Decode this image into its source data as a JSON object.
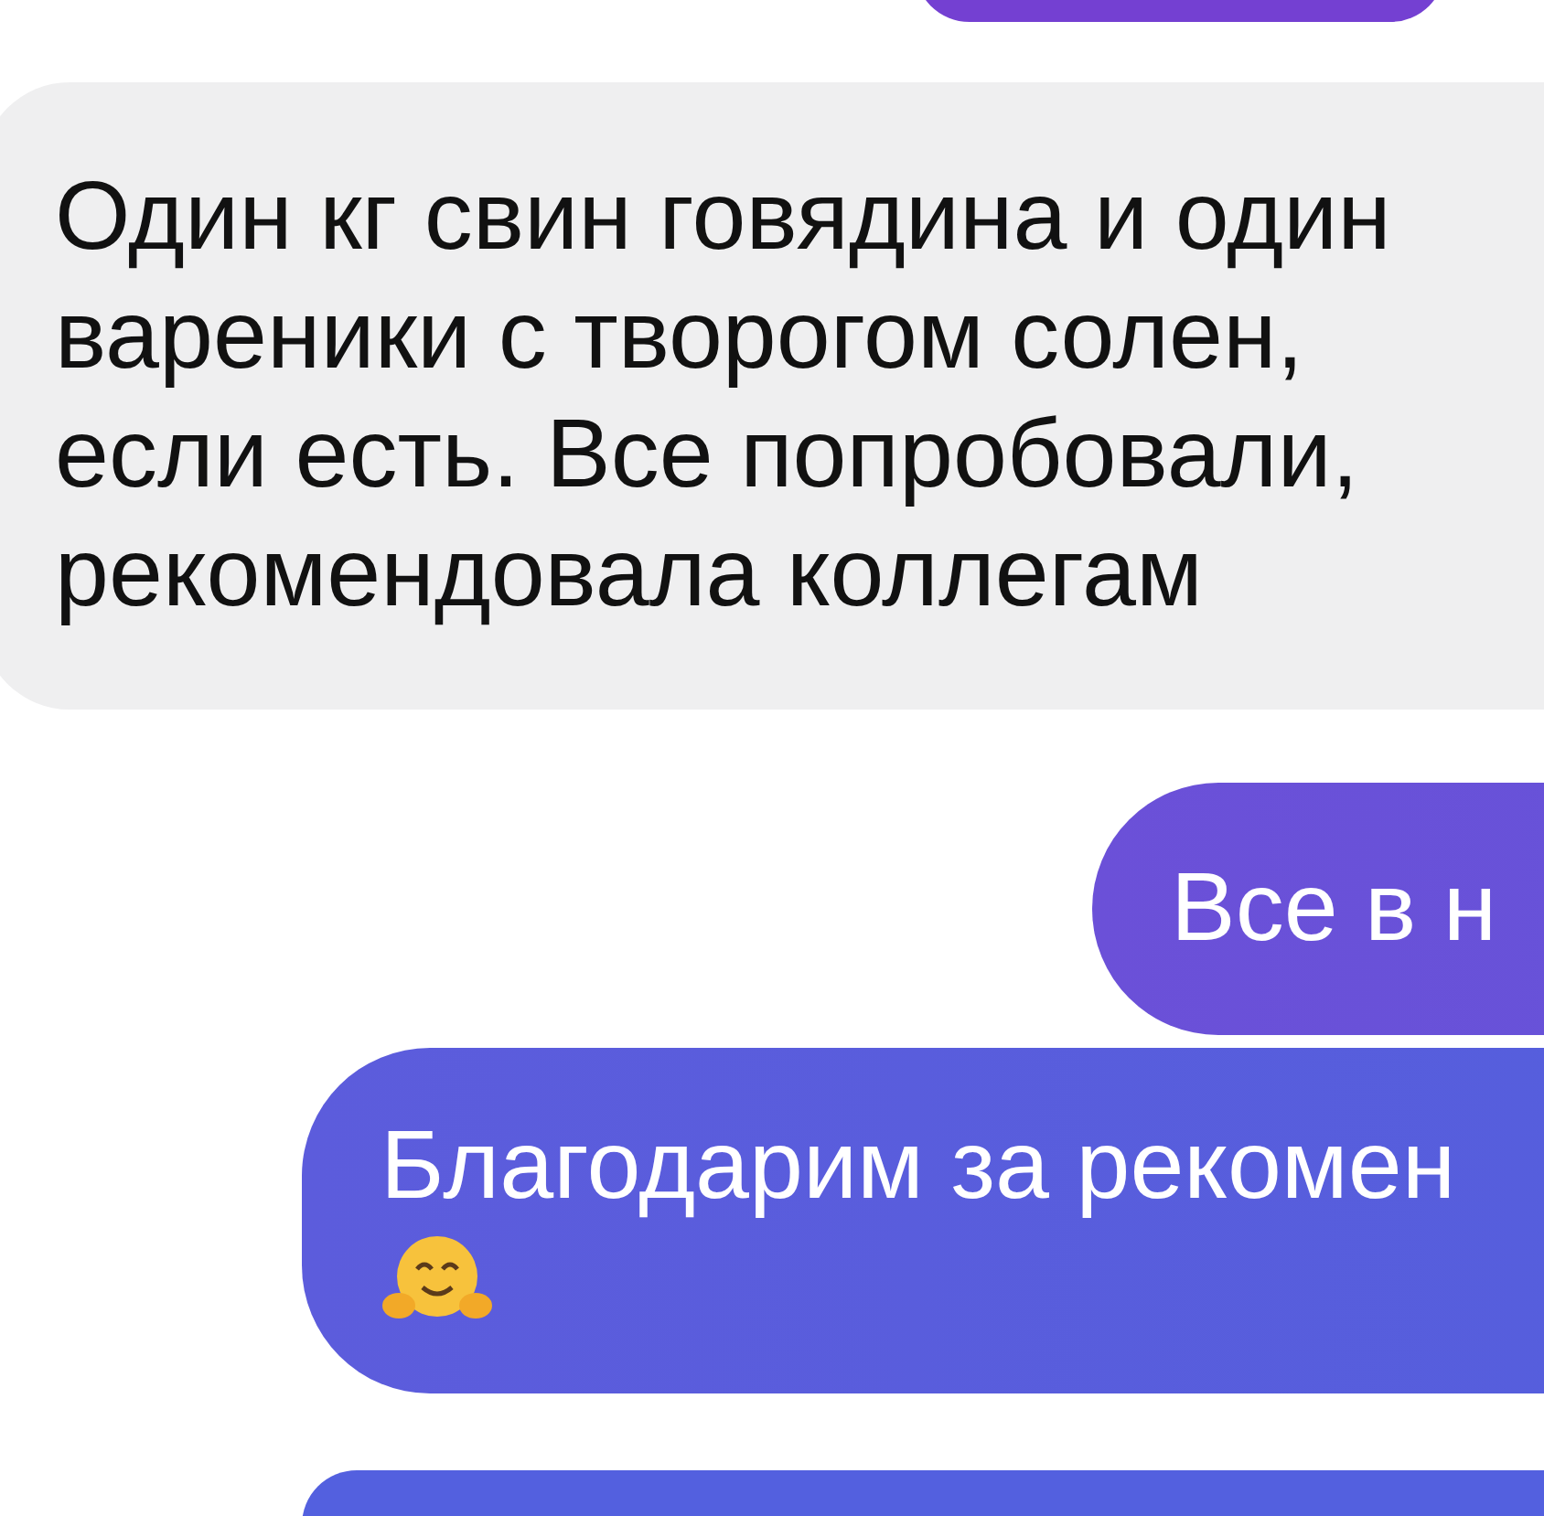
{
  "messages": [
    {
      "kind": "sent-edge"
    },
    {
      "kind": "received",
      "lines": [
        "Один кг свин говядина и один",
        "вареники с творогом солен,",
        "если есть. Все попробовали,",
        "рекомендовала коллегам"
      ]
    },
    {
      "kind": "sent",
      "lines": [
        "Все в н"
      ],
      "has_emoji": false
    },
    {
      "kind": "sent",
      "lines": [
        "Благодарим за рекомен"
      ],
      "has_emoji": true
    },
    {
      "kind": "sent-edge"
    }
  ]
}
